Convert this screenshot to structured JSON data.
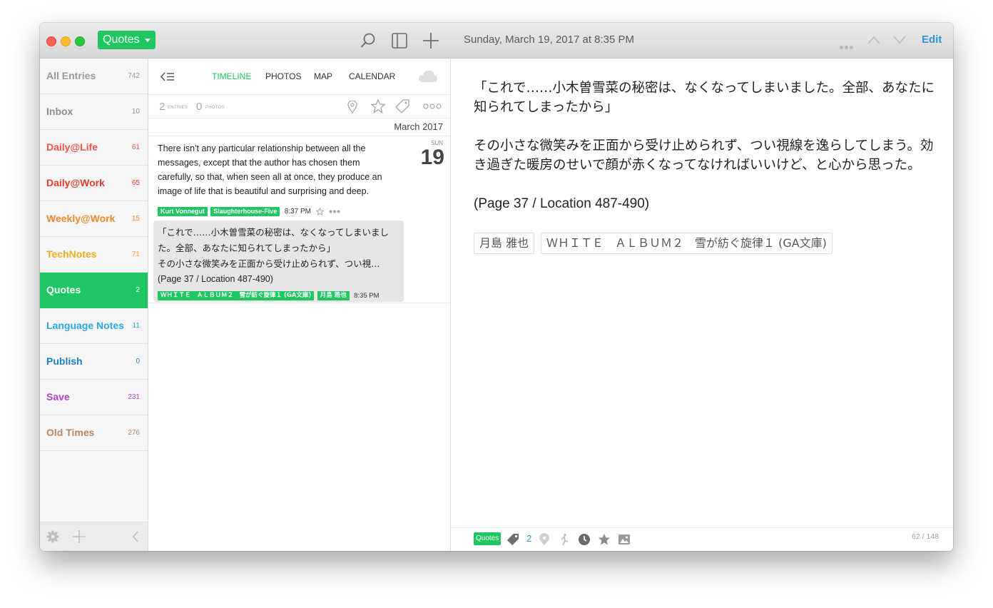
{
  "titlebar": {
    "journal_button": "Quotes",
    "date": "Sunday, March 19, 2017 at 8:35 PM",
    "edit_label": "Edit"
  },
  "sidebar": {
    "items": [
      {
        "label": "All Entries",
        "count": "742",
        "color": "#9a9a9a"
      },
      {
        "label": "Inbox",
        "count": "10",
        "color": "#8e8e8e"
      },
      {
        "label": "Daily@Life",
        "count": "61",
        "color": "#f0524f"
      },
      {
        "label": "Daily@Work",
        "count": "65",
        "color": "#e83a2c"
      },
      {
        "label": "Weekly@Work",
        "count": "15",
        "color": "#f08a2a"
      },
      {
        "label": "TechNotes",
        "count": "71",
        "color": "#f4aa1e"
      },
      {
        "label": "Quotes",
        "count": "2",
        "color": "#1ec761"
      },
      {
        "label": "Language Notes",
        "count": "11",
        "color": "#2ba7e6"
      },
      {
        "label": "Publish",
        "count": "0",
        "color": "#1a7fc7"
      },
      {
        "label": "Save",
        "count": "231",
        "color": "#b045c9"
      },
      {
        "label": "Old Times",
        "count": "276",
        "color": "#b58763"
      }
    ],
    "active_index": 6
  },
  "timeline": {
    "tabs": [
      "TIMELINE",
      "PHOTOS",
      "MAP",
      "CALENDAR"
    ],
    "active_tab": 0,
    "stats": {
      "entries_num": "2",
      "entries_label": "ENTRIES",
      "photos_num": "0",
      "photos_label": "PHOTOS"
    },
    "month_header": "March 2017",
    "day_label": "SUN",
    "day_number": "19",
    "entries": [
      {
        "text": "There isn't any particular relationship between all the messages, except that the author has chosen them carefully, so that, when seen all at once, they produce an image of life that is beautiful and surprising and deep.",
        "tags": [
          "Kurt Vonnegut",
          "Slaughterhouse-Five"
        ],
        "time": "8:37 PM"
      },
      {
        "lines": [
          "「これで……小木曽雪菜の秘密は、なくなってしまいまし",
          "た。全部、あなたに知られてしまったから」",
          "その小さな微笑みを正面から受け止められず、つい視…",
          "(Page 37 / Location 487-490)"
        ],
        "tags": [
          "ＷＨＩＴＥ　ＡＬＢＵＭ２　雪が紡ぐ旋律１ (GA文庫)",
          "月島 雅也"
        ],
        "time": "8:35 PM"
      }
    ]
  },
  "content": {
    "paragraphs": [
      "「これで……小木曽雪菜の秘密は、なくなってしまいました。全部、あなたに知られてしまったから」",
      "その小さな微笑みを正面から受け止められず、つい視線を逸らしてしまう。効き過ぎた暖房のせいで顔が赤くなってなければいいけど、と心から思った。",
      "(Page 37 / Location 487-490)"
    ],
    "tags": [
      "月島 雅也",
      "ＷＨＩＴＥ　ＡＬＢＵＭ２　雪が紡ぐ旋律１ (GA文庫)"
    ],
    "footer": {
      "journal_tag": "Quotes",
      "tag_count": "2",
      "word_count": "62  /  148"
    }
  }
}
